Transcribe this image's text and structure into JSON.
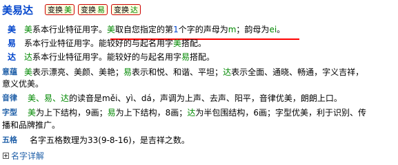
{
  "title": "美易达",
  "buttons": [
    {
      "label": "变换",
      "char": "美"
    },
    {
      "label": "变换",
      "char": "易"
    },
    {
      "label": "变换",
      "char": "达"
    }
  ],
  "meanings": [
    {
      "label": "美",
      "char": "美",
      "text": "系本行业特征用字。",
      "h1": "美",
      "h2": "取自您指定的第",
      "h3": "1",
      "h4": "个字的声母为",
      "h5": "m",
      "h6": "；韵母为",
      "h7": "ei",
      "h8": "。"
    },
    {
      "label": "易",
      "text": "系本行业特征用字。能较好的与起名用字",
      "hl": "美",
      "tail": "搭配。"
    },
    {
      "label": "达",
      "char": "达",
      "text": "系本行业特征用字。能较好的与起名用字",
      "hl": "易",
      "tail": "搭配。"
    }
  ],
  "yiyun": {
    "label": "意蕴",
    "line1_a": "美",
    "line1_b": "表示漂亮、美颜、美艳；",
    "line1_c": "易",
    "line1_d": "表示和悦、和谐、平坦；",
    "line1_e": "达",
    "line1_f": "表示全面、通晓、畅通，字义吉祥，",
    "line2": "意义优美。"
  },
  "yinlv": {
    "label": "音律",
    "chars": "美、易、达",
    "text": "的读音是měi、yì、dá，声调为上声、去声、阳平，音律优美，朗朗上口。"
  },
  "zixing": {
    "label": "字型",
    "c1": "美",
    "t1": "为上下结构，9画；",
    "c2": "易",
    "t2": "为上下结构，8画；",
    "c3": "达",
    "t3": "为半包围结构，6画；字型优美，利于识别、传",
    "line2": "播和品牌推广。"
  },
  "wuge": {
    "label": "五格",
    "text": "名字五格数理为33(9-8-16)，是吉祥之数。"
  },
  "detail_link": "名字详解"
}
